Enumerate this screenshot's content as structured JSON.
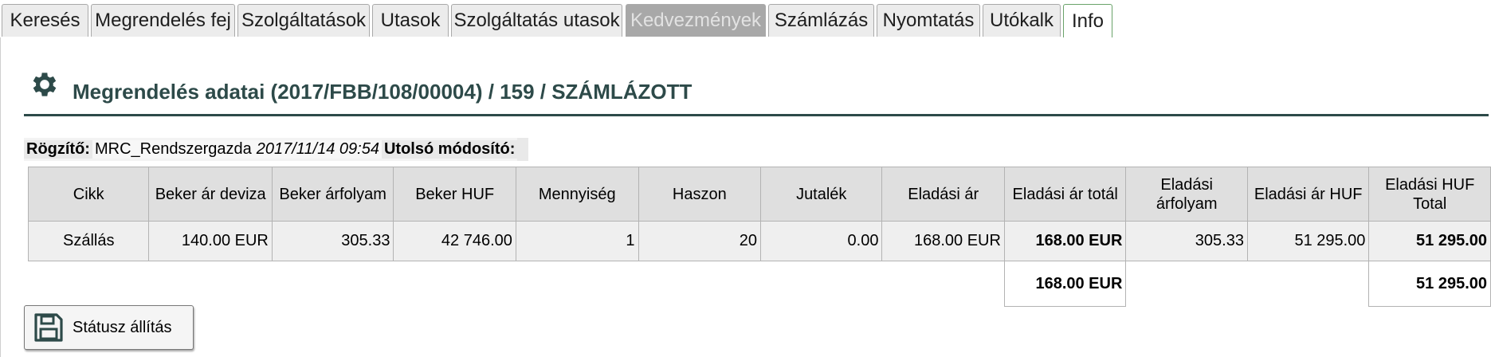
{
  "tabs": [
    {
      "label": "Keresés",
      "state": "normal"
    },
    {
      "label": "Megrendelés fej",
      "state": "normal"
    },
    {
      "label": "Szolgáltatások",
      "state": "normal"
    },
    {
      "label": "Utasok",
      "state": "normal"
    },
    {
      "label": "Szolgáltatás utasok",
      "state": "normal"
    },
    {
      "label": "Kedvezmények",
      "state": "disabled"
    },
    {
      "label": "Számlázás",
      "state": "normal"
    },
    {
      "label": "Nyomtatás",
      "state": "normal"
    },
    {
      "label": "Utókalk",
      "state": "normal"
    },
    {
      "label": "Info",
      "state": "active"
    }
  ],
  "header": {
    "icon": "gear-icon",
    "title": "Megrendelés adatai (2017/FBB/108/00004) / 159 / SZÁMLÁZOTT"
  },
  "info": {
    "recorder_label": "Rögzítő:",
    "recorder_value": "MRC_Rendszergazda",
    "recorded_at": "2017/11/14 09:54",
    "last_modifier_label": "Utolsó módosító:",
    "last_modifier_value": ""
  },
  "table": {
    "columns": [
      "Cikk",
      "Beker ár deviza",
      "Beker árfolyam",
      "Beker HUF",
      "Mennyiség",
      "Haszon",
      "Jutalék",
      "Eladási ár",
      "Eladási ár totál",
      "Eladási árfolyam",
      "Eladási ár HUF",
      "Eladási HUF Total"
    ],
    "rows": [
      [
        "Szállás",
        "140.00 EUR",
        "305.33",
        "42 746.00",
        "1",
        "20",
        "0.00",
        "168.00 EUR",
        "168.00 EUR",
        "305.33",
        "51 295.00",
        "51 295.00"
      ]
    ],
    "totals": {
      "eladasi_ar_total": "168.00 EUR",
      "eladasi_huf_total": "51 295.00"
    }
  },
  "button": {
    "label": "Státusz állítás",
    "icon": "save-icon"
  },
  "colors": {
    "title": "#2d4a49",
    "active_tab_border": "#6aa36a",
    "disabled_tab": "#a8a8a8"
  }
}
